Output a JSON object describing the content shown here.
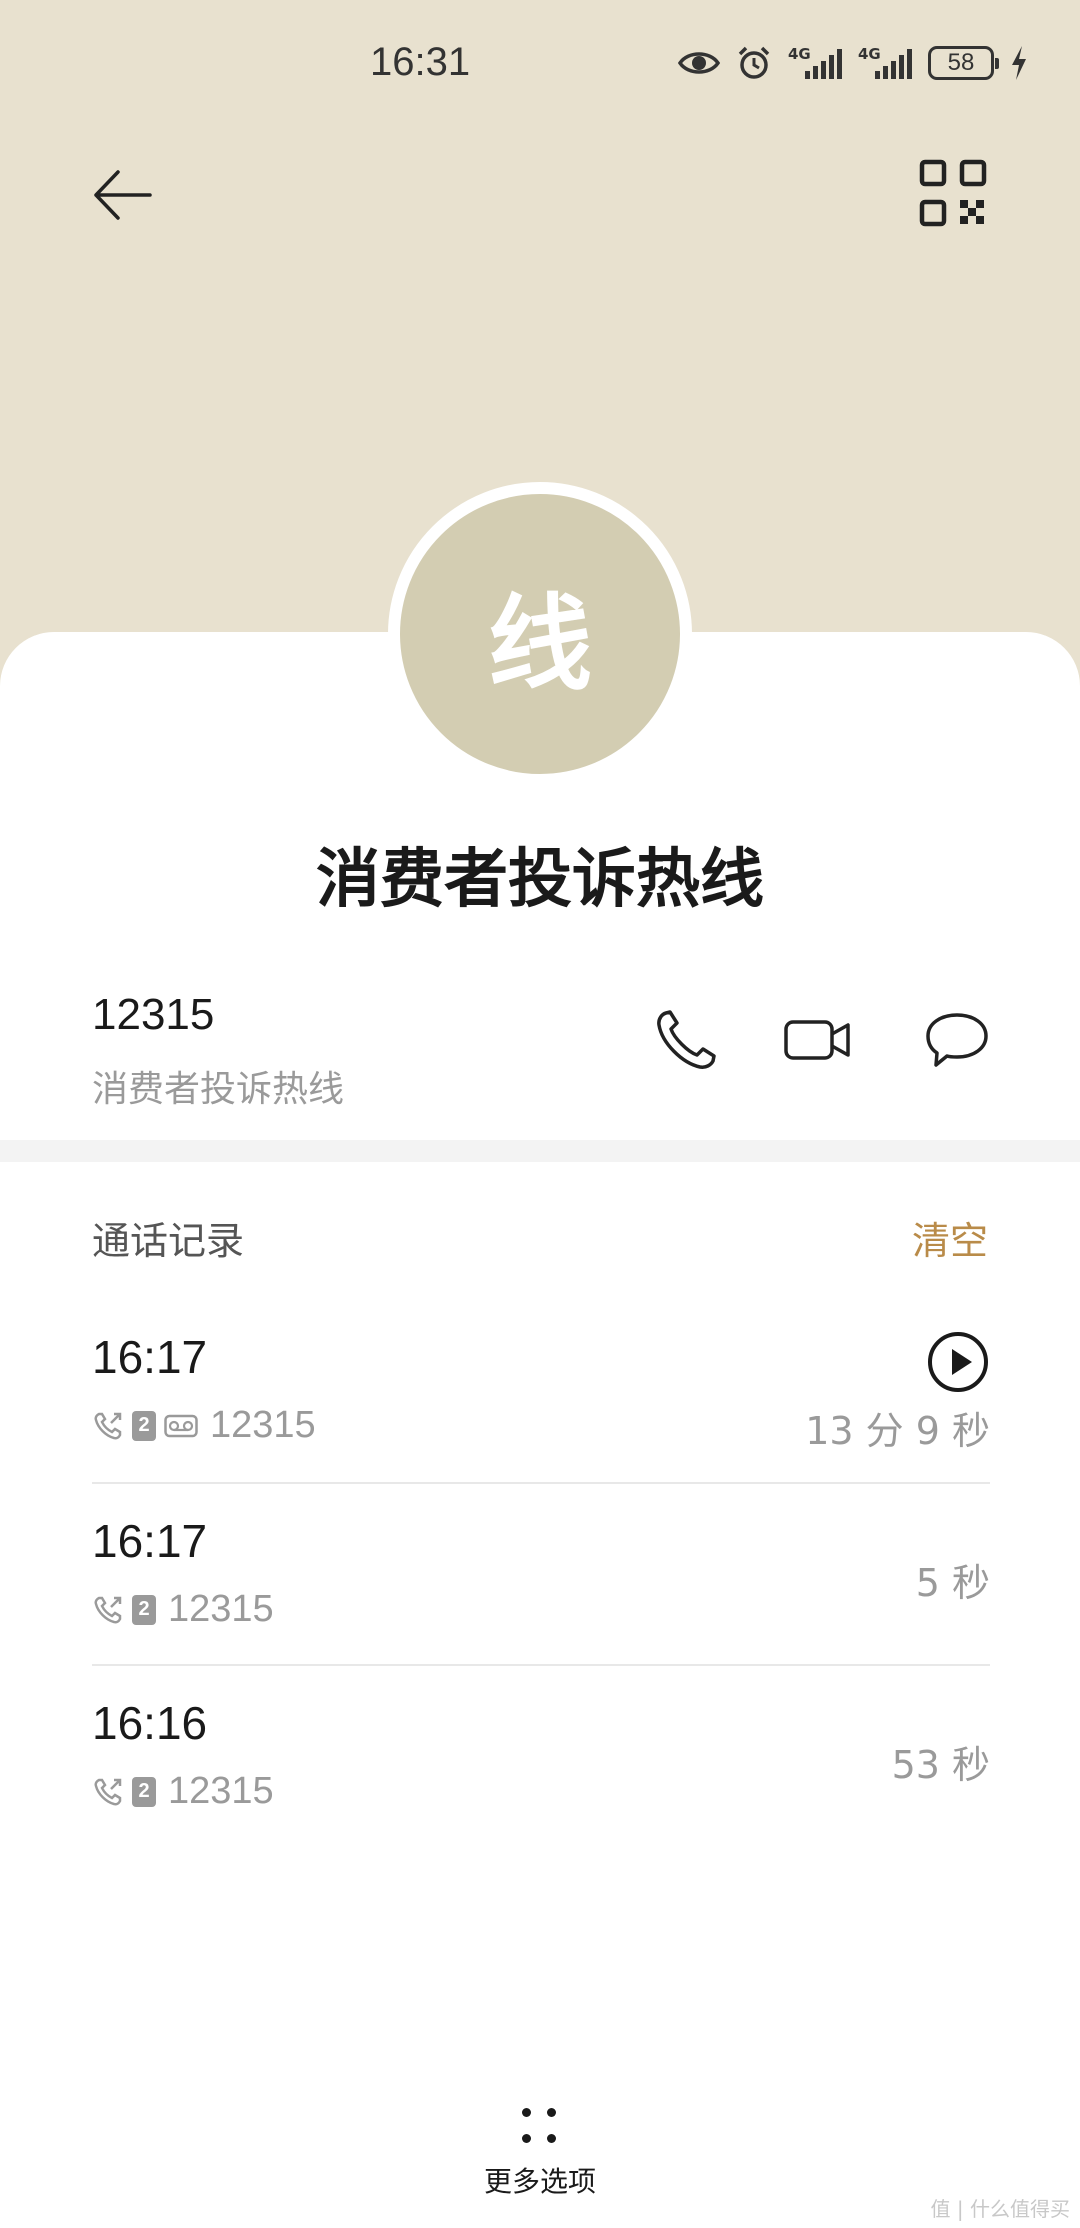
{
  "status_bar": {
    "time": "16:31",
    "network_1": "4G",
    "network_2": "4G",
    "battery": "58"
  },
  "header": {
    "back_icon": "arrow-left-icon",
    "qr_icon": "qr-code-icon",
    "background": "#e8e1cf"
  },
  "contact": {
    "avatar_char": "线",
    "avatar_color": "#d3cdb2",
    "name": "消费者投诉热线",
    "number": "12315",
    "number_label": "消费者投诉热线",
    "actions": [
      "phone-icon",
      "video-call-icon",
      "message-icon"
    ]
  },
  "call_log": {
    "title": "通话记录",
    "clear_label": "清空",
    "accent": "#b98b49",
    "records": [
      {
        "time": "16:17",
        "number": "12315",
        "sim": "2",
        "duration": "13 分 9 秒",
        "has_recording": true
      },
      {
        "time": "16:17",
        "number": "12315",
        "sim": "2",
        "duration": "5 秒",
        "has_recording": false
      },
      {
        "time": "16:16",
        "number": "12315",
        "sim": "2",
        "duration": "53 秒",
        "has_recording": false
      }
    ]
  },
  "footer": {
    "more_label": "更多选项"
  },
  "watermark": "值 | 什么值得买"
}
